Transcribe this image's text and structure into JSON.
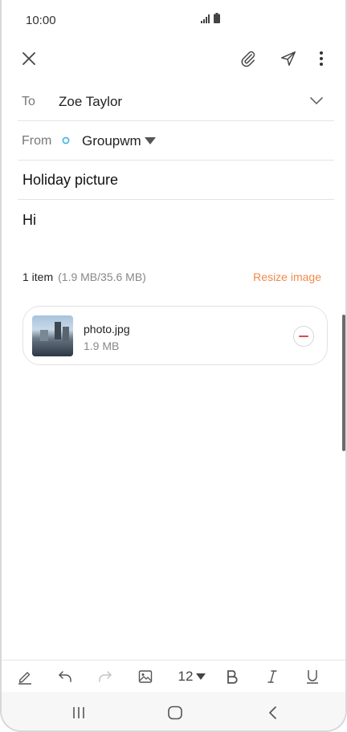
{
  "status": {
    "time": "10:00"
  },
  "compose": {
    "to_label": "To",
    "to_value": "Zoe Taylor",
    "from_label": "From",
    "from_value": "Groupwm",
    "subject": "Holiday picture",
    "body": "Hi"
  },
  "attachments": {
    "count_label": "1 item",
    "size_summary": "(1.9 MB/35.6 MB)",
    "resize_label": "Resize image",
    "items": [
      {
        "name": "photo.jpg",
        "size": "1.9 MB"
      }
    ]
  },
  "format_bar": {
    "font_size": "12"
  },
  "colors": {
    "accent": "#f08a4b",
    "remove": "#e04848",
    "account_dot": "#3fb3e6"
  }
}
